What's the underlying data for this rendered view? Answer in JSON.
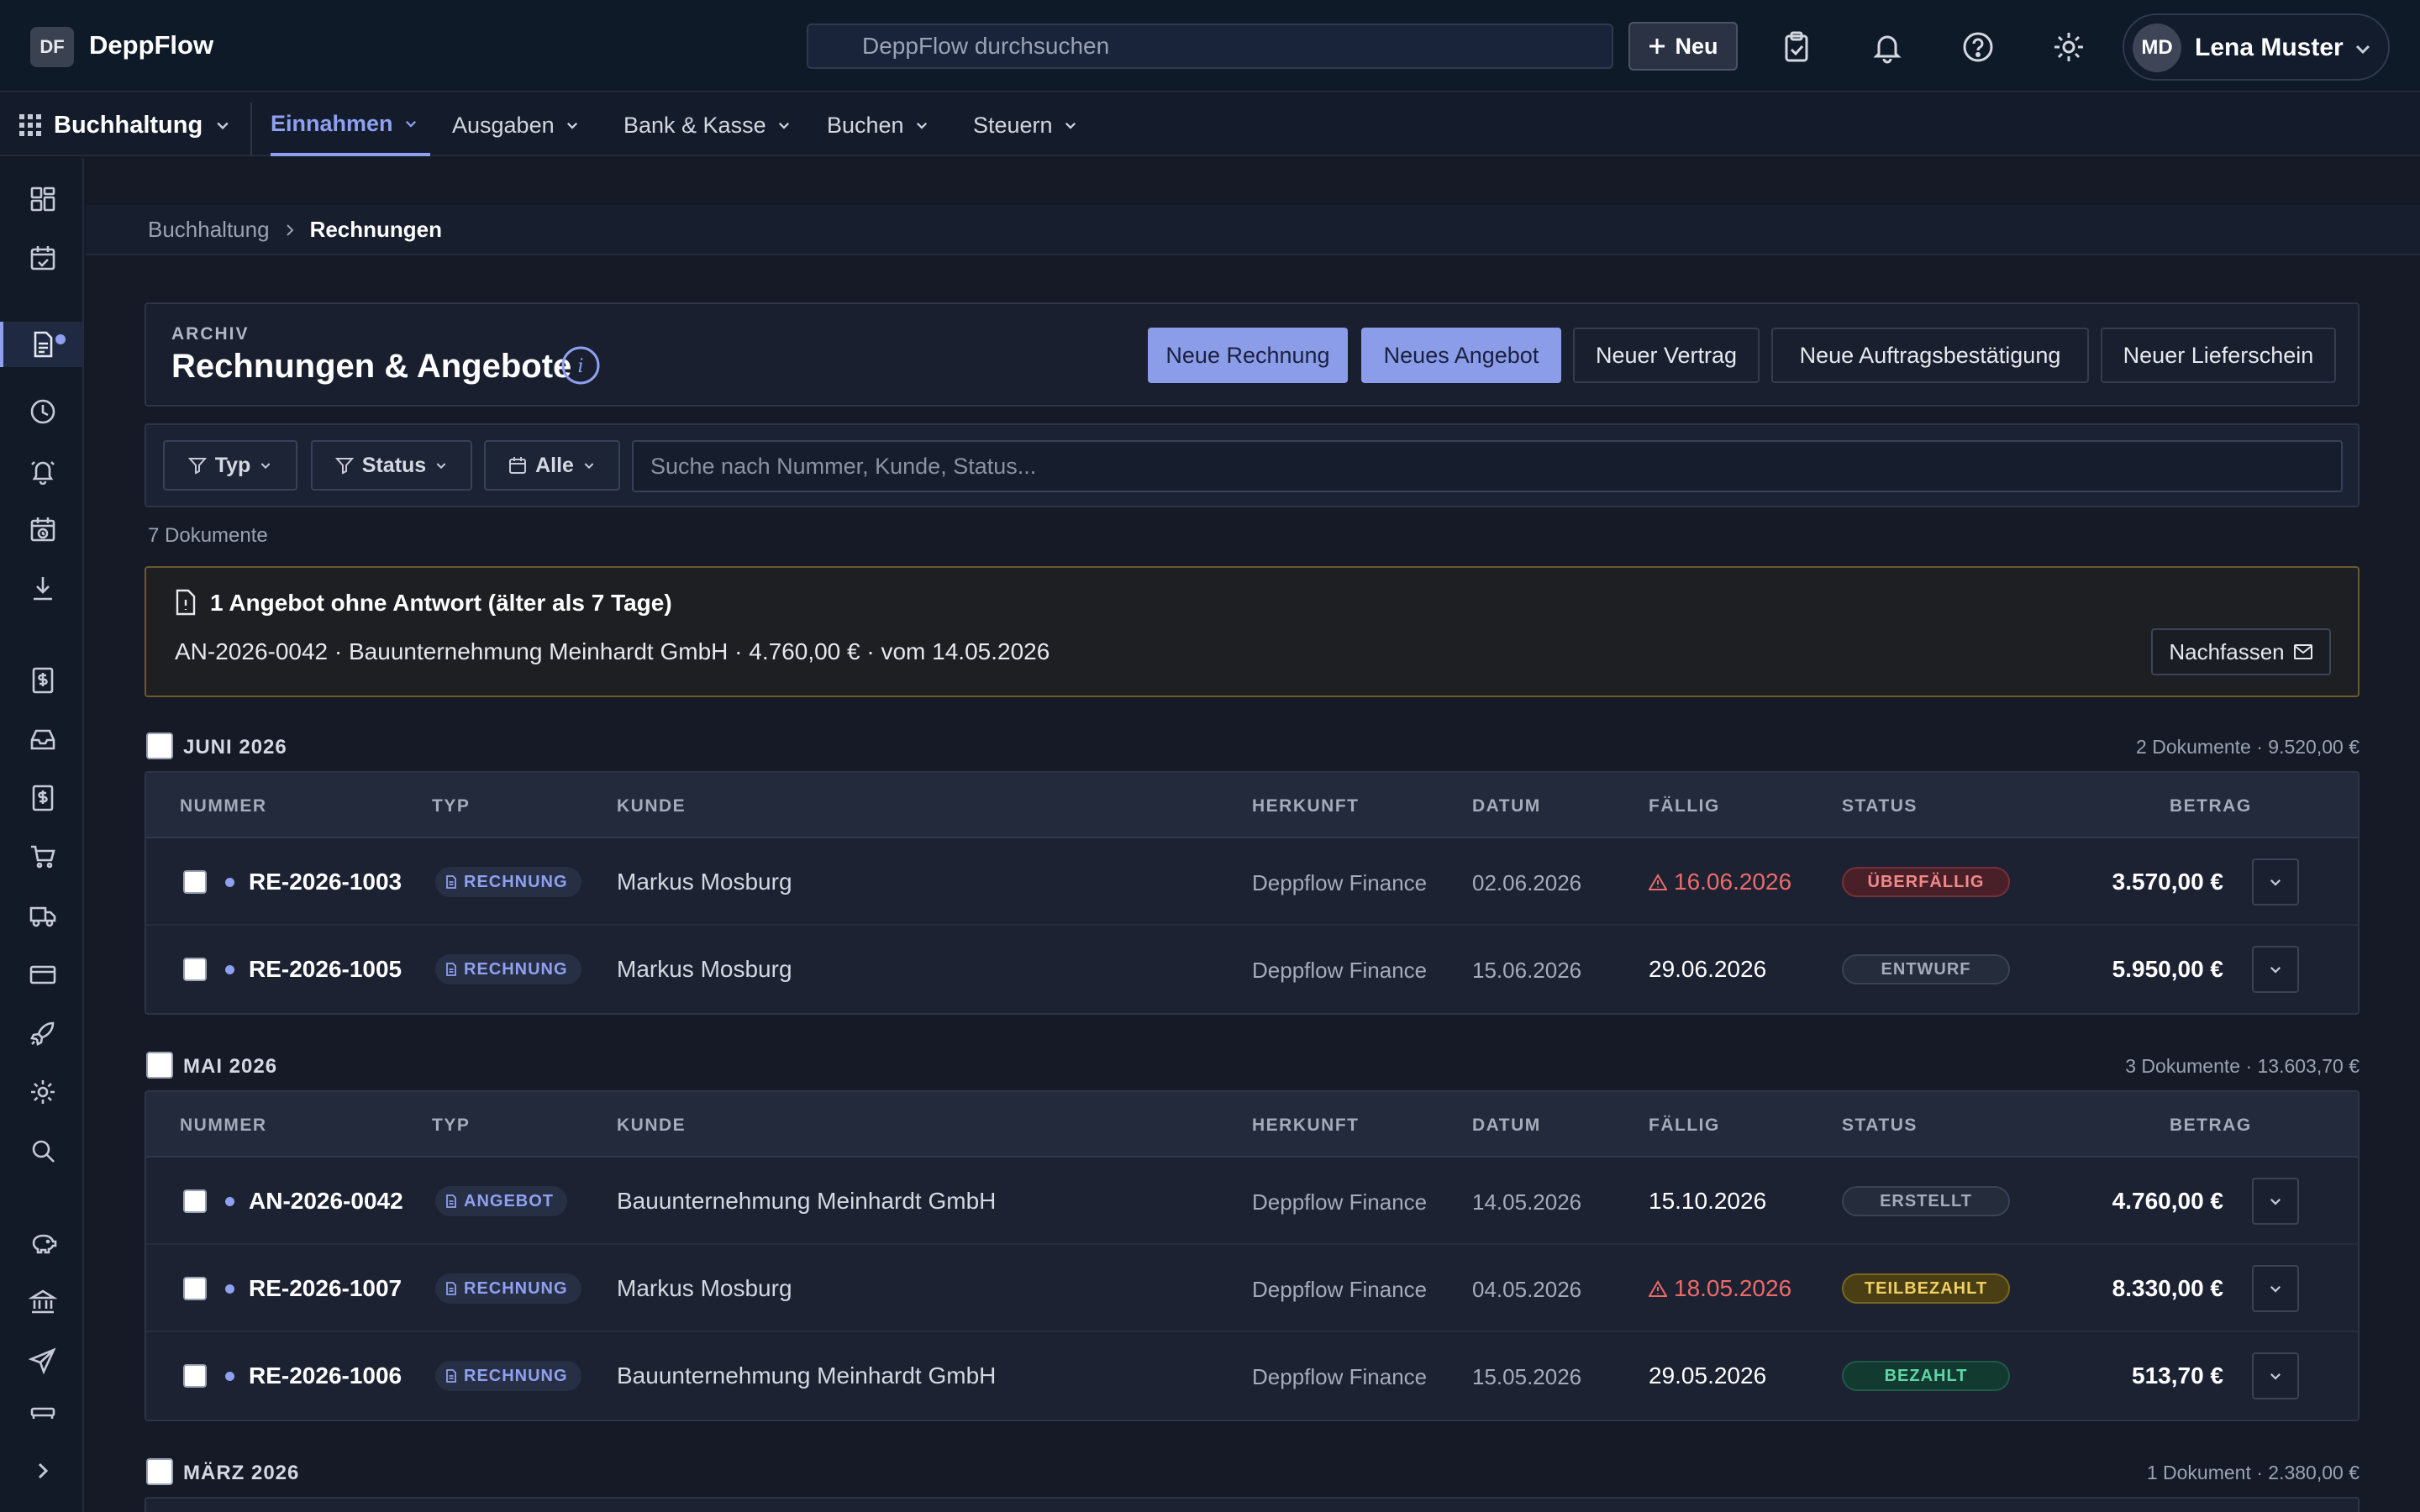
{
  "app": {
    "logo": "DF",
    "name": "DeppFlow",
    "search_placeholder": "DeppFlow durchsuchen",
    "new_label": "Neu",
    "user_initials": "MD",
    "user_name": "Lena Muster"
  },
  "modnav": {
    "module": "Buchhaltung",
    "tabs": [
      {
        "label": "Einnahmen"
      },
      {
        "label": "Ausgaben"
      },
      {
        "label": "Bank & Kasse"
      },
      {
        "label": "Buchen"
      },
      {
        "label": "Steuern"
      }
    ]
  },
  "breadcrumb": {
    "parent": "Buchhaltung",
    "current": "Rechnungen"
  },
  "header": {
    "eyebrow": "ARCHIV",
    "title": "Rechnungen & Angebote",
    "buttons": {
      "new_invoice": "Neue Rechnung",
      "new_offer": "Neues Angebot",
      "new_contract": "Neuer Vertrag",
      "new_order_confirmation": "Neue Auftragsbestätigung",
      "new_delivery_note": "Neuer Lieferschein"
    }
  },
  "filters": {
    "type": "Typ",
    "status": "Status",
    "period": "Alle",
    "search_placeholder": "Suche nach Nummer, Kunde, Status..."
  },
  "doc_count": "7 Dokumente",
  "alert": {
    "title": "1 Angebot ohne Antwort (älter als 7 Tage)",
    "text": "AN-2026-0042 · Bauunternehmung Meinhardt GmbH · 4.760,00 € · vom 14.05.2026",
    "button": "Nachfassen"
  },
  "columns": {
    "nummer": "NUMMER",
    "typ": "TYP",
    "kunde": "KUNDE",
    "herkunft": "HERKUNFT",
    "datum": "DATUM",
    "faellig": "FÄLLIG",
    "status": "STATUS",
    "betrag": "BETRAG"
  },
  "groups": [
    {
      "label": "JUNI 2026",
      "summary": "2 Dokumente · 9.520,00 €",
      "rows": [
        {
          "nummer": "RE-2026-1003",
          "typ": "RECHNUNG",
          "kunde": "Markus Mosburg",
          "herkunft": "Deppflow Finance",
          "datum": "02.06.2026",
          "faellig": "16.06.2026",
          "status": "ÜBERFÄLLIG",
          "betrag": "3.570,00 €"
        },
        {
          "nummer": "RE-2026-1005",
          "typ": "RECHNUNG",
          "kunde": "Markus Mosburg",
          "herkunft": "Deppflow Finance",
          "datum": "15.06.2026",
          "faellig": "29.06.2026",
          "status": "ENTWURF",
          "betrag": "5.950,00 €"
        }
      ]
    },
    {
      "label": "MAI 2026",
      "summary": "3 Dokumente · 13.603,70 €",
      "rows": [
        {
          "nummer": "AN-2026-0042",
          "typ": "ANGEBOT",
          "kunde": "Bauunternehmung Meinhardt GmbH",
          "herkunft": "Deppflow Finance",
          "datum": "14.05.2026",
          "faellig": "15.10.2026",
          "status": "ERSTELLT",
          "betrag": "4.760,00 €"
        },
        {
          "nummer": "RE-2026-1007",
          "typ": "RECHNUNG",
          "kunde": "Markus Mosburg",
          "herkunft": "Deppflow Finance",
          "datum": "04.05.2026",
          "faellig": "18.05.2026",
          "status": "TEILBEZAHLT",
          "betrag": "8.330,00 €"
        },
        {
          "nummer": "RE-2026-1006",
          "typ": "RECHNUNG",
          "kunde": "Bauunternehmung Meinhardt GmbH",
          "herkunft": "Deppflow Finance",
          "datum": "15.05.2026",
          "faellig": "29.05.2026",
          "status": "BEZAHLT",
          "betrag": "513,70 €"
        }
      ]
    },
    {
      "label": "MÄRZ 2026",
      "summary": "1 Dokument · 2.380,00 €",
      "rows": []
    }
  ],
  "colors": {
    "accent": "#8fa0f0",
    "overdue": "#ee6a6a",
    "status_overdue_bg": "#4a2028",
    "status_partial_bg": "#4a3e14",
    "status_paid_bg": "#123a30"
  }
}
